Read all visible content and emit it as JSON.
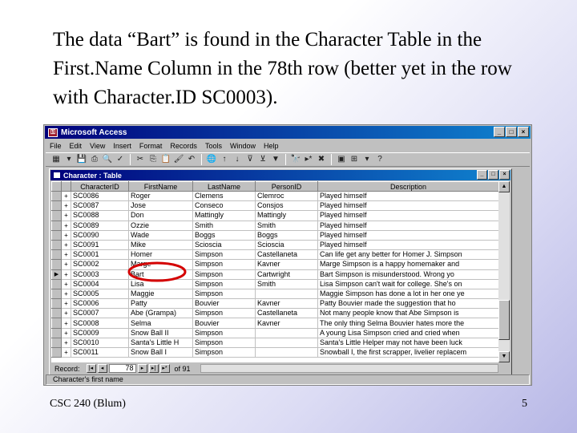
{
  "slide": {
    "title": "The data “Bart” is found in the Character Table in the First.Name Column in the 78th row (better yet in the row with Character.ID SC0003).",
    "footer": "CSC 240 (Blum)",
    "page_number": "5"
  },
  "app": {
    "title": "Microsoft Access",
    "menu": [
      "File",
      "Edit",
      "View",
      "Insert",
      "Format",
      "Records",
      "Tools",
      "Window",
      "Help"
    ]
  },
  "child": {
    "title": "Character : Table"
  },
  "table": {
    "columns": [
      "CharacterID",
      "FirstName",
      "LastName",
      "PersonID",
      "Description"
    ],
    "rows": [
      [
        "SC0086",
        "Roger",
        "Clemens",
        "Clemroc",
        "Played himself"
      ],
      [
        "SC0087",
        "Jose",
        "Conseco",
        "Consjos",
        "Played himself"
      ],
      [
        "SC0088",
        "Don",
        "Mattingly",
        "Mattingly",
        "Played himself"
      ],
      [
        "SC0089",
        "Ozzie",
        "Smith",
        "Smith",
        "Played himself"
      ],
      [
        "SC0090",
        "Wade",
        "Boggs",
        "Boggs",
        "Played himself"
      ],
      [
        "SC0091",
        "Mike",
        "Scioscia",
        "Scioscia",
        "Played himself"
      ],
      [
        "SC0001",
        "Homer",
        "Simpson",
        "Castellaneta",
        "Can life get any better for Homer J. Simpson"
      ],
      [
        "SC0002",
        "Marge",
        "Simpson",
        "Kavner",
        "Marge Simpson is a happy homemaker and"
      ],
      [
        "SC0003",
        "Bart",
        "Simpson",
        "Cartwright",
        "Bart Simpson is misunderstood. Wrong yo"
      ],
      [
        "SC0004",
        "Lisa",
        "Simpson",
        "Smith",
        "Lisa Simpson can't wait for college. She's on"
      ],
      [
        "SC0005",
        "Maggie",
        "Simpson",
        "",
        "Maggie Simpson has done a lot in her one ye"
      ],
      [
        "SC0006",
        "Patty",
        "Bouvier",
        "Kavner",
        "Patty Bouvier made the suggestion that ho"
      ],
      [
        "SC0007",
        "Abe (Grampa)",
        "Simpson",
        "Castellaneta",
        "Not many people know that Abe Simpson is"
      ],
      [
        "SC0008",
        "Selma",
        "Bouvier",
        "Kavner",
        "The only thing Selma Bouvier hates more the"
      ],
      [
        "SC0009",
        "Snow Ball II",
        "Simpson",
        "",
        "A young Lisa Simpson cried and cried when"
      ],
      [
        "SC0010",
        "Santa's Little H",
        "Simpson",
        "",
        "Santa's Little Helper may not have been luck"
      ],
      [
        "SC0011",
        "Snow Ball I",
        "Simpson",
        "",
        "Snowball I, the first scrapper, livelier replacem"
      ]
    ],
    "current_row_index": 8
  },
  "navigation": {
    "label": "Record:",
    "current": "78",
    "of_label": "of 91"
  },
  "status": {
    "text": "Character's first name"
  },
  "colors": {
    "highlight": "#d40000",
    "title_bar": "#00007b"
  }
}
